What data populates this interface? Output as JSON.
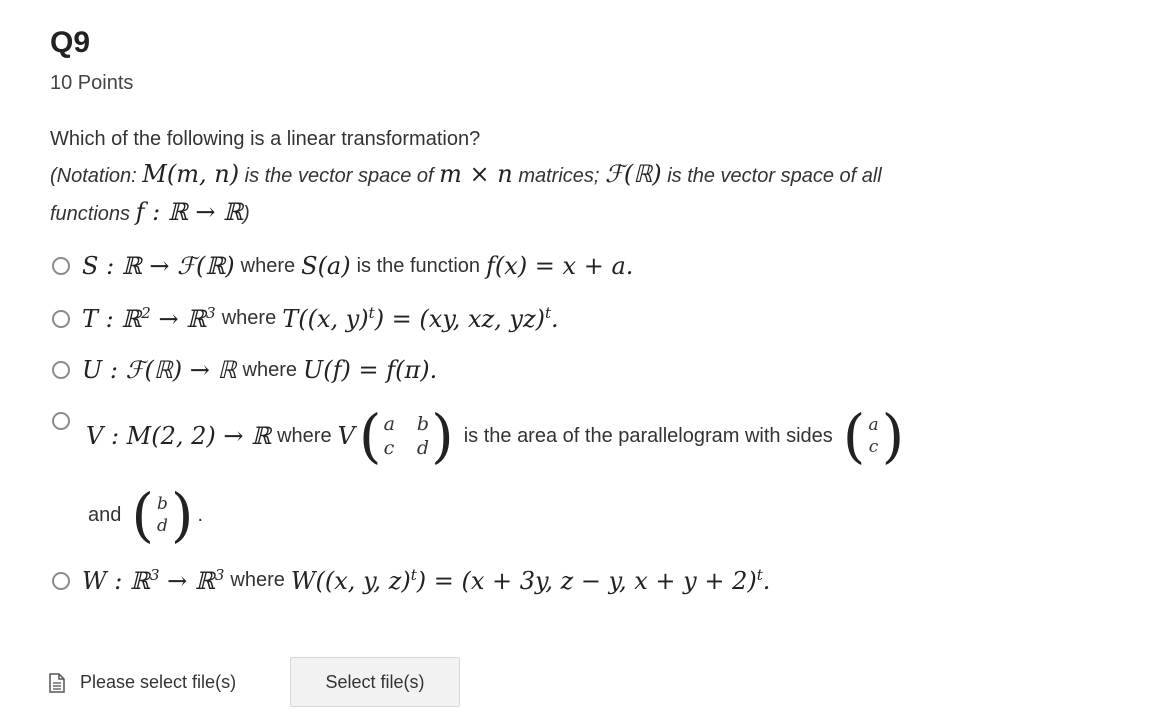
{
  "question": {
    "title": "Q9",
    "points": "10 Points",
    "prompt": "Which of the following is a linear transformation?",
    "notation": {
      "open": "(Notation:",
      "m_mn": "M(m, n)",
      "is1": "is the vector space of",
      "mxn": "m × n",
      "matrices": "matrices;",
      "f_r": "ℱ(ℝ)",
      "is2": "is the vector space of all",
      "functions": "functions",
      "f_map": "f : ℝ → ℝ",
      "close": ")"
    }
  },
  "options": [
    {
      "math1": "S : ℝ → ℱ(ℝ)",
      "where": "where",
      "math2": "S(a)",
      "text2": "is the function",
      "math3": "f(x) = x + a."
    },
    {
      "math1": "T : ℝ",
      "sup1": "2",
      "arrow": "→ ℝ",
      "sup2": "3",
      "where": "where",
      "math2": "T((x, y)",
      "sup3": "t",
      "math3": ") = (xy, xz, yz)",
      "sup4": "t",
      "end": "."
    },
    {
      "math1": "U : ℱ(ℝ) → ℝ",
      "where": "where",
      "math2": "U(f) = f(π)."
    },
    {
      "math1": "V : M(2, 2) → ℝ",
      "where": "where",
      "math2": "V",
      "matrix": [
        "a",
        "b",
        "c",
        "d"
      ],
      "text2": "is the area of the parallelogram with sides",
      "vec1": [
        "a",
        "c"
      ],
      "and": "and",
      "vec2": [
        "b",
        "d"
      ],
      "end": "."
    },
    {
      "math1": "W : ℝ",
      "sup1": "3",
      "arrow": "→ ℝ",
      "sup2": "3",
      "where": "where",
      "math2": "W((x, y, z)",
      "sup3": "t",
      "math3": ") = (x + 3y, z − y, x + y + 2)",
      "sup4": "t",
      "end": "."
    }
  ],
  "upload": {
    "icon": "document-icon",
    "label": "Please select file(s)",
    "button": "Select file(s)"
  },
  "colors": {
    "radio_border": "#8a8a8a",
    "button_bg": "#f2f2f2"
  }
}
